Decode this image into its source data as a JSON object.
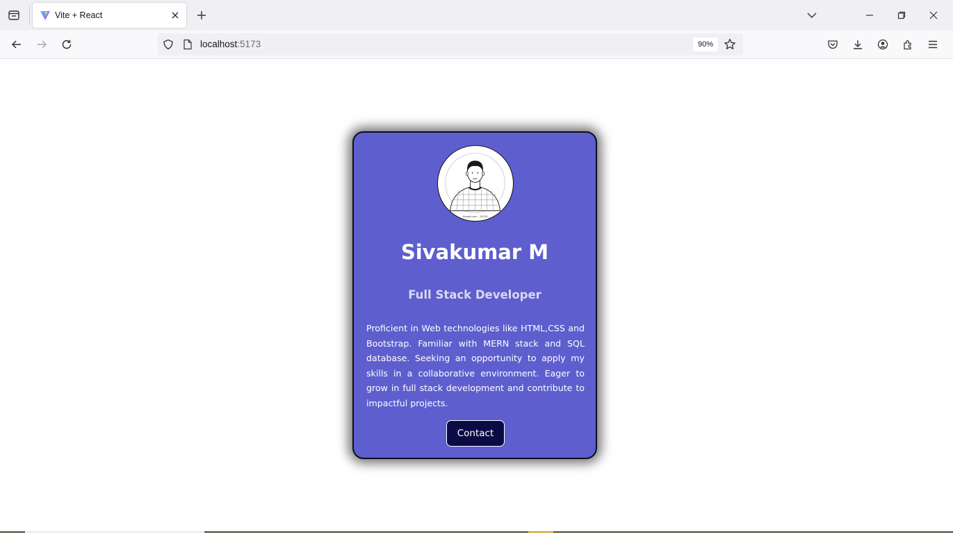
{
  "browser": {
    "tab_title": "Vite + React",
    "url_host": "localhost",
    "url_port": ":5173",
    "zoom": "90%"
  },
  "profile": {
    "name": "Sivakumar M",
    "role": "Full Stack Developer",
    "description": "Proficient in Web technologies like HTML,CSS and Bootstrap. Familiar with MERN stack and SQL database. Seeking an opportunity to apply my skills in a collaborative environment. Eager to grow in full stack development and contribute to impactful projects.",
    "contact_label": "Contact",
    "avatar_watermark": "freepik.com - 25078"
  },
  "colors": {
    "card_bg": "#5e5ecf",
    "button_bg": "#0a0a45",
    "role_text": "#d9d9ee"
  }
}
